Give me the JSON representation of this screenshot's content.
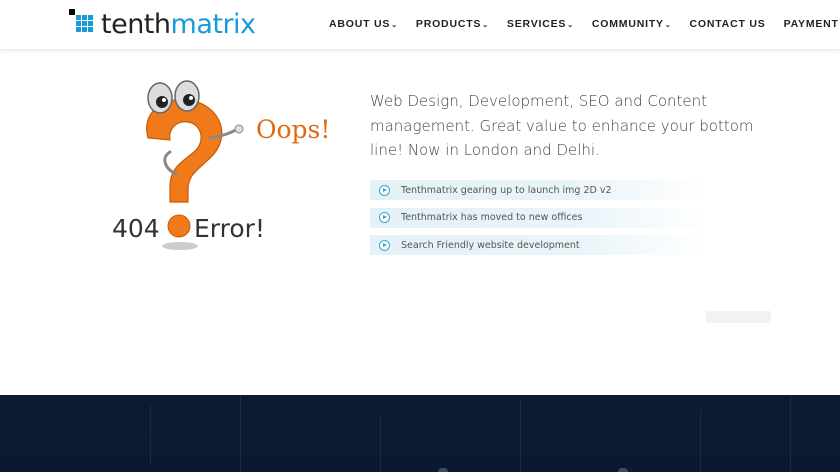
{
  "brand": {
    "name_part1": "tenth",
    "name_part2": "matrix",
    "primary_color": "#1a9bd7"
  },
  "nav": {
    "items": [
      {
        "label": "ABOUT US",
        "dropdown": true
      },
      {
        "label": "PRODUCTS",
        "dropdown": true
      },
      {
        "label": "SERVICES",
        "dropdown": true
      },
      {
        "label": "COMMUNITY",
        "dropdown": true
      },
      {
        "label": "CONTACT US",
        "dropdown": false
      },
      {
        "label": "PAYMENT",
        "dropdown": true
      }
    ],
    "dropdown_glyph": "⌄"
  },
  "error_art": {
    "oops_text": "Oops!",
    "code_text": "404",
    "error_text": "Error!",
    "icon": "question-mark-character"
  },
  "hero": {
    "tagline": "Web Design, Development, SEO and Content management. Great value to enhance your bottom line! Now in London and Delhi."
  },
  "news": [
    {
      "text": "Tenthmatrix gearing up to launch img 2D v2",
      "icon": "play-circle-icon"
    },
    {
      "text": "Tenthmatrix has moved to new offices",
      "icon": "play-circle-icon"
    },
    {
      "text": "Search Friendly website development",
      "icon": "play-circle-icon"
    }
  ],
  "colors": {
    "footer_bg": "#0c1b33",
    "accent": "#3aa3d3",
    "question_orange": "#f07a1a"
  }
}
